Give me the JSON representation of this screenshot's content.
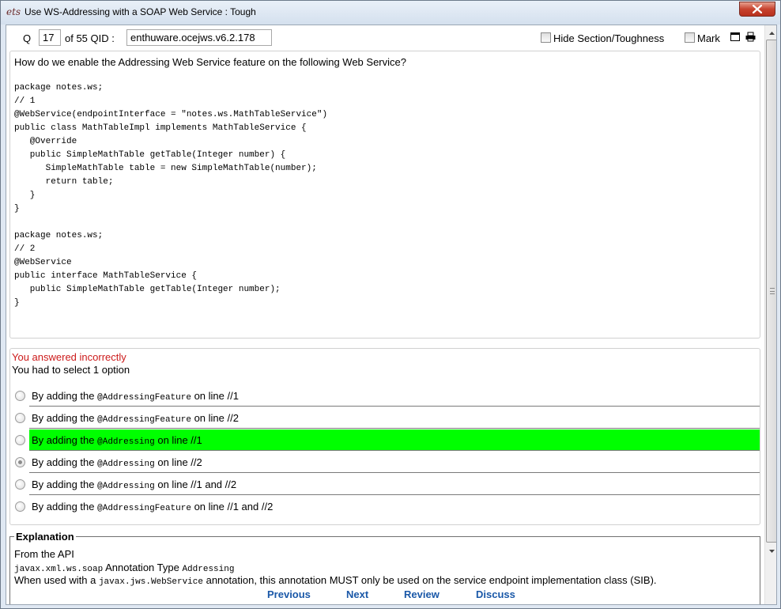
{
  "window": {
    "app_icon_text": "ets",
    "title": "Use WS-Addressing with a SOAP Web Service : Tough"
  },
  "toolbar": {
    "q_label": "Q",
    "q_value": "17",
    "of_label": "of 55 QID :",
    "qid_value": "enthuware.ocejws.v6.2.178",
    "hide_label": "Hide Section/Toughness",
    "mark_label": "Mark"
  },
  "question": {
    "text": "How do we enable the Addressing Web Service feature on the following Web Service?",
    "code": "package notes.ws;\n// 1\n@WebService(endpointInterface = \"notes.ws.MathTableService\")\npublic class MathTableImpl implements MathTableService {\n   @Override\n   public SimpleMathTable getTable(Integer number) {\n      SimpleMathTable table = new SimpleMathTable(number);\n      return table;\n   }\n}\n\npackage notes.ws;\n// 2\n@WebService\npublic interface MathTableService {\n   public SimpleMathTable getTable(Integer number);\n}"
  },
  "result": {
    "status": "You answered incorrectly",
    "instructions": "You had to select 1 option"
  },
  "options": [
    {
      "prefix": "By adding the ",
      "code": "@AddressingFeature",
      "suffix": " on line //1",
      "selected": false,
      "correct": false
    },
    {
      "prefix": "By adding the ",
      "code": "@AddressingFeature",
      "suffix": " on line //2",
      "selected": false,
      "correct": false
    },
    {
      "prefix": "By adding the ",
      "code": "@Addressing",
      "suffix": " on line //1",
      "selected": false,
      "correct": true
    },
    {
      "prefix": "By adding the ",
      "code": "@Addressing",
      "suffix": " on line //2",
      "selected": true,
      "correct": false
    },
    {
      "prefix": "By adding the ",
      "code": "@Addressing",
      "suffix": " on line //1 and //2",
      "selected": false,
      "correct": false
    },
    {
      "prefix": "By adding the ",
      "code": "@AddressingFeature",
      "suffix": " on line //1 and //2",
      "selected": false,
      "correct": false
    }
  ],
  "explanation": {
    "title": "Explanation",
    "line1": "From the API",
    "line2_code": "javax.xml.ws.soap",
    "line2_mid": " Annotation Type ",
    "line2_code2": "Addressing",
    "line3_prefix": "When used with a ",
    "line3_code": "javax.jws.WebService",
    "line3_suffix": " annotation, this annotation MUST only be used on the service endpoint implementation class (SIB)."
  },
  "nav": {
    "previous": "Previous",
    "next": "Next",
    "review": "Review",
    "discuss": "Discuss"
  },
  "colors": {
    "correct_highlight": "#00ff00",
    "incorrect_text": "#cc1a1a",
    "nav_link": "#1a58a8"
  },
  "icons": [
    "close-icon",
    "window-icon",
    "print-icon",
    "scroll-up-icon",
    "scroll-down-icon"
  ]
}
